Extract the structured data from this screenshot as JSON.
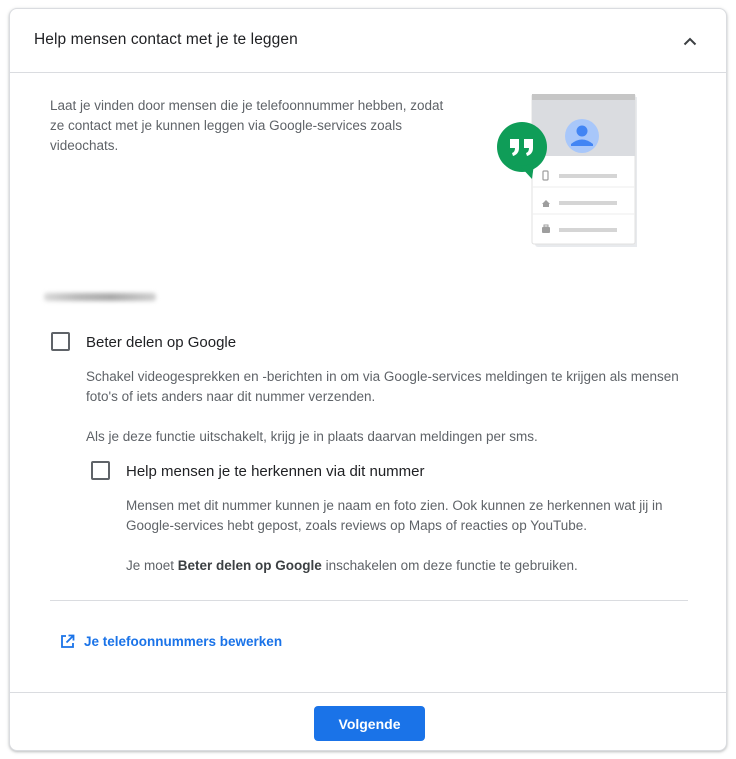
{
  "header": {
    "title": "Help mensen contact met je te leggen",
    "collapse_icon": "chevron-up-icon"
  },
  "intro": {
    "text": "Laat je vinden door mensen die je telefoonnummer hebben, zodat ze contact met je kunnen leggen via Google-services zoals videochats."
  },
  "illustration": {
    "icons": [
      "hangouts-quote-icon",
      "avatar-icon",
      "phone-icon",
      "home-icon",
      "work-icon"
    ],
    "colors": {
      "hangouts_green": "#0f9d58",
      "avatar_blue": "#4285f4",
      "avatar_bg": "#a8c7fa"
    }
  },
  "options": [
    {
      "label": "Beter delen op Google",
      "checked": false,
      "description_1": "Schakel videogesprekken en -berichten in om via Google-services meldingen te krijgen als mensen foto's of iets anders naar dit nummer verzenden.",
      "description_2": "Als je deze functie uitschakelt, krijg je in plaats daarvan meldingen per sms."
    },
    {
      "label": "Help mensen je te herkennen via dit nummer",
      "checked": false,
      "description_1": "Mensen met dit nummer kunnen je naam en foto zien. Ook kunnen ze herkennen wat jij in Google-services hebt gepost, zoals reviews op Maps of reacties op YouTube.",
      "description_2_prefix": "Je moet ",
      "description_2_bold": "Beter delen op Google",
      "description_2_suffix": " inschakelen om deze functie te gebruiken."
    }
  ],
  "edit_link": {
    "label": "Je telefoonnummers bewerken",
    "icon": "open-in-new-icon"
  },
  "footer": {
    "next_label": "Volgende"
  },
  "colors": {
    "accent": "#1a73e8",
    "text_primary": "#202124",
    "text_secondary": "#5f6368",
    "divider": "#dadce0"
  }
}
